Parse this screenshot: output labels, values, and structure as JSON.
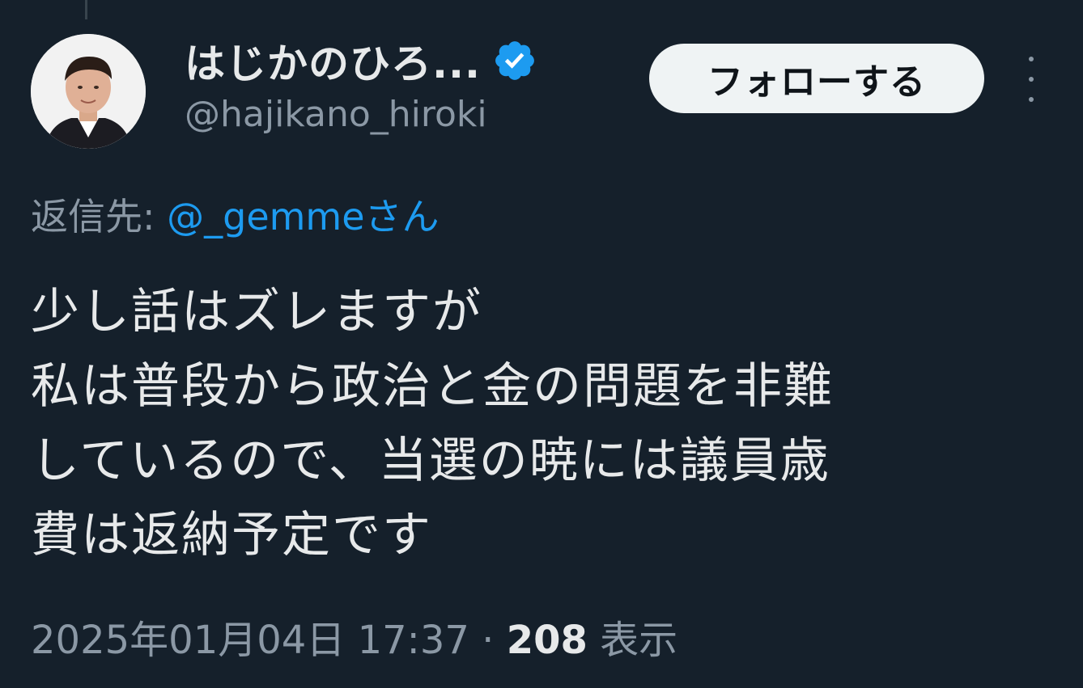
{
  "header": {
    "display_name": "はじかのひろ...",
    "handle": "@hajikano_hiroki",
    "follow_label": "フォローする"
  },
  "reply": {
    "prefix": "返信先: ",
    "handle": "@_gemmeさん"
  },
  "tweet": {
    "lines": [
      "少し話はズレますが",
      "私は普段から政治と金の問題を非難",
      "しているので、当選の暁には議員歳",
      "費は返納予定です"
    ]
  },
  "meta": {
    "timestamp": "2025年01月04日 17:37",
    "separator": " · ",
    "views_count": "208",
    "views_label": " 表示"
  },
  "icons": {
    "verified": "verified-badge-icon",
    "more": "more-options-icon",
    "avatar": "avatar"
  },
  "colors": {
    "background": "#15202b",
    "text": "#e7e9ea",
    "secondary": "#8b98a5",
    "link": "#1d9bf0",
    "verified": "#1d9bf0",
    "follow_bg": "#eff3f4"
  }
}
